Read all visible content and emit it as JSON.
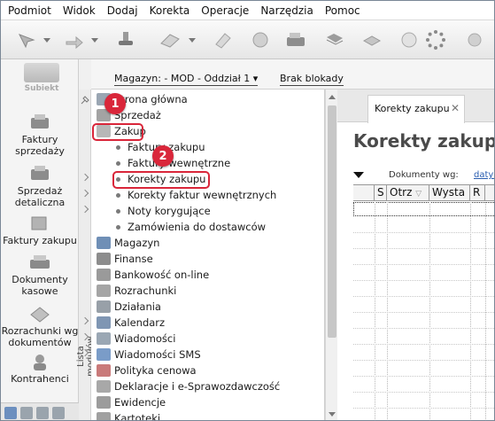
{
  "menu": [
    "Podmiot",
    "Widok",
    "Dodaj",
    "Korekta",
    "Operacje",
    "Narzędzia",
    "Pomoc"
  ],
  "brand": {
    "name": "Subiekt"
  },
  "leftnav": [
    {
      "label": "Faktury\nsprzedaży",
      "icon": "invoices-icon"
    },
    {
      "label": "Sprzedaż\ndetaliczna",
      "icon": "retail-icon"
    },
    {
      "label": "Faktury zakupu",
      "icon": "purchase-invoices-icon"
    },
    {
      "label": "Dokumenty\nkasowe",
      "icon": "cash-documents-icon"
    },
    {
      "label": "Rozrachunki wg\ndokumentów",
      "icon": "settlements-icon"
    },
    {
      "label": "Kontrahenci",
      "icon": "contractors-icon"
    }
  ],
  "magazyn": {
    "label": "Magazyn: - MOD - Oddział 1",
    "blokada": "Brak blokady"
  },
  "module_panel_label": "Lista modułów",
  "tree": {
    "items": [
      {
        "label": "Strona główna",
        "kind": "top"
      },
      {
        "label": "Sprzedaż",
        "kind": "top"
      },
      {
        "label": "Zakup",
        "kind": "top",
        "highlight": true
      },
      {
        "label": "Faktury zakupu",
        "kind": "sub"
      },
      {
        "label": "Faktury wewnętrzne",
        "kind": "sub"
      },
      {
        "label": "Korekty zakupu",
        "kind": "sub",
        "highlight": true
      },
      {
        "label": "Korekty faktur wewnętrznych",
        "kind": "sub"
      },
      {
        "label": "Noty korygujące",
        "kind": "sub"
      },
      {
        "label": "Zamówienia do dostawców",
        "kind": "sub"
      },
      {
        "label": "Magazyn",
        "kind": "top"
      },
      {
        "label": "Finanse",
        "kind": "top"
      },
      {
        "label": "Bankowość on-line",
        "kind": "top"
      },
      {
        "label": "Rozrachunki",
        "kind": "top"
      },
      {
        "label": "Działania",
        "kind": "top"
      },
      {
        "label": "Kalendarz",
        "kind": "top"
      },
      {
        "label": "Wiadomości",
        "kind": "top"
      },
      {
        "label": "Wiadomości SMS",
        "kind": "top"
      },
      {
        "label": "Polityka cenowa",
        "kind": "top"
      },
      {
        "label": "Deklaracje i e-Sprawozdawczość",
        "kind": "top"
      },
      {
        "label": "Ewidencje",
        "kind": "top"
      },
      {
        "label": "Kartoteki",
        "kind": "top"
      }
    ]
  },
  "badges": [
    "1",
    "2"
  ],
  "content": {
    "tab_label": "Korekty zakupu",
    "title": "Korekty zakupu",
    "documents_label": "Dokumenty wg:",
    "documents_link": "daty o",
    "columns": [
      "S",
      "Otrz",
      "Wysta",
      "R"
    ]
  },
  "colors": {
    "highlight": "#d9263a",
    "link": "#2a5db0"
  }
}
